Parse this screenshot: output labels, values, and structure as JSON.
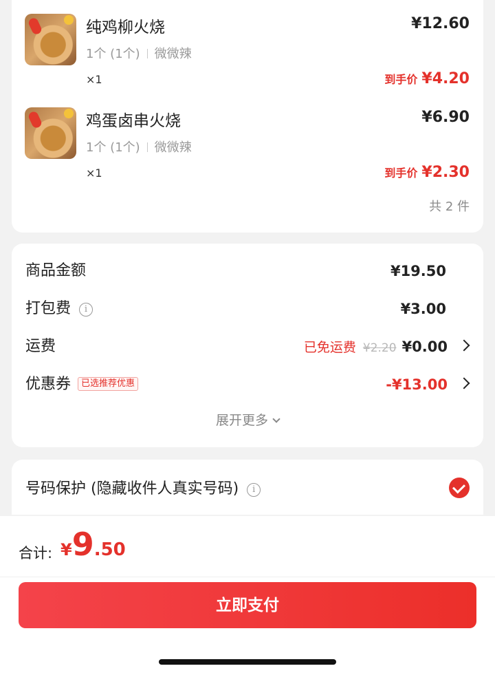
{
  "items": [
    {
      "name": "纯鸡柳火烧",
      "spec_count": "1个 (1个)",
      "spec_flavor": "微微辣",
      "qty": "×1",
      "price": "¥12.60",
      "final_label": "到手价",
      "final_price": "¥4.20",
      "thumb_icon": "food-thumbnail-icon"
    },
    {
      "name": "鸡蛋卤串火烧",
      "spec_count": "1个 (1个)",
      "spec_flavor": "微微辣",
      "qty": "×1",
      "price": "¥6.90",
      "final_label": "到手价",
      "final_price": "¥2.30",
      "thumb_icon": "food-thumbnail-icon"
    }
  ],
  "total_count": "共 2 件",
  "fees": {
    "goods_label": "商品金额",
    "goods_value": "¥19.50",
    "packing_label": "打包费",
    "packing_value": "¥3.00",
    "shipping_label": "运费",
    "shipping_note": "已免运费",
    "shipping_original": "¥2.20",
    "shipping_value": "¥0.00",
    "coupon_label": "优惠券",
    "coupon_tag": "已选推荐优惠",
    "coupon_value": "-¥13.00",
    "expand_label": "展开更多"
  },
  "privacy": {
    "label": "号码保护 (隐藏收件人真实号码)",
    "checked": true
  },
  "summary": {
    "label": "合计:",
    "currency": "¥",
    "integer": "9",
    "decimal": ".50"
  },
  "pay_button": "立即支付",
  "colors": {
    "accent": "#e4312b",
    "background": "#f2f2f2",
    "card": "#ffffff"
  }
}
